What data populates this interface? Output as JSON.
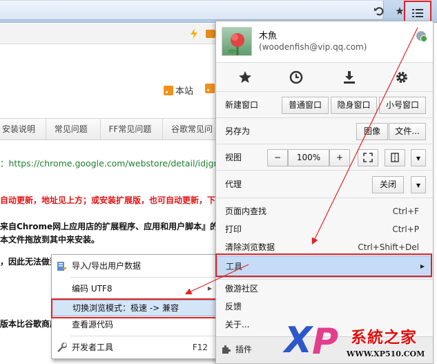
{
  "page": {
    "rss_site": "本站",
    "nav_tabs": [
      "安装说明",
      "常见问题",
      "FF常见问题",
      "谷歌常见问"
    ],
    "url_line": "：https://chrome.google.com/webstore/detail/idjgma",
    "red_line": "自动更新，地址见上方；或安装扩展版，也可自动更新，下载",
    "bold_line1": "来自Chrome网上应用店的扩展程序、应用和用户脚本』的复",
    "bold_line2": "本文件拖放到其中来安装。",
    "line_cut": "，因此无法做到",
    "line_cut2": "版本比谷歌商店"
  },
  "menu": {
    "profile": {
      "name": "木魚",
      "email": "(woodenfish@vip.qq.com)"
    },
    "icons": [
      "star-icon",
      "history-icon",
      "download-icon",
      "settings-icon"
    ],
    "new_window": {
      "label": "新建窗口",
      "buttons": [
        "普通窗口",
        "隐身窗口",
        "小号窗口"
      ]
    },
    "save_as": {
      "label": "另存为",
      "buttons": [
        "图像",
        "文件..."
      ]
    },
    "view": {
      "label": "视图",
      "minus": "−",
      "zoom": "100%",
      "plus": "+"
    },
    "proxy": {
      "label": "代理",
      "value": "关闭"
    },
    "items1": [
      {
        "label": "页面内查找",
        "shortcut": "Ctrl+F"
      },
      {
        "label": "打印",
        "shortcut": "Ctrl+P"
      },
      {
        "label": "清除浏览数据",
        "shortcut": "Ctrl+Shift+Del"
      }
    ],
    "tools": "工具",
    "items2": [
      "傲游社区",
      "反馈",
      "关于..."
    ],
    "plugins": "插件"
  },
  "submenu": {
    "import_export": "导入/导出用户数据",
    "encoding": "编码 UTF8",
    "switch_mode": "切换浏览模式：极速 -> 兼容",
    "view_source": "查看源代码",
    "devtools": "开发者工具",
    "devtools_shortcut": "F12"
  },
  "watermark": {
    "brand": "系統之家",
    "url": "WWW.XP510.COM"
  },
  "colors": {
    "highlight": "#c5dcf6",
    "annotation_red": "#e32222",
    "link_green": "#1f7f2d"
  }
}
